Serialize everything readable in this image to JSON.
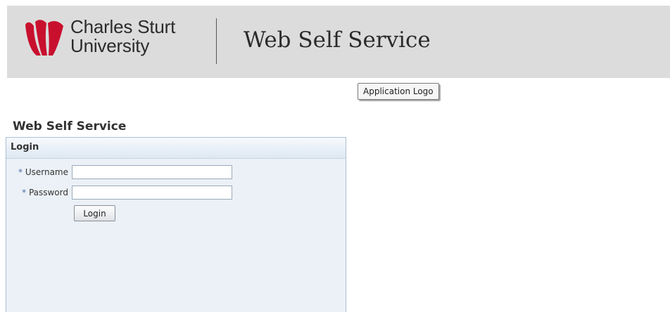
{
  "header": {
    "brand_line1": "Charles Sturt",
    "brand_line2": "University",
    "app_title": "Web Self Service",
    "logo_tooltip": "Application Logo"
  },
  "page": {
    "heading": "Web Self Service"
  },
  "login_panel": {
    "title": "Login",
    "required_marker": "*",
    "username_label": "Username",
    "username_value": "",
    "password_label": "Password",
    "password_value": "",
    "submit_label": "Login"
  },
  "colors": {
    "logo_red": "#c8102e",
    "header_background": "#dcdcdc",
    "panel_background": "#ecf1f7",
    "panel_border": "#aabfd6"
  },
  "icons": {
    "university_logo": "charles-sturt-flame-logo"
  }
}
